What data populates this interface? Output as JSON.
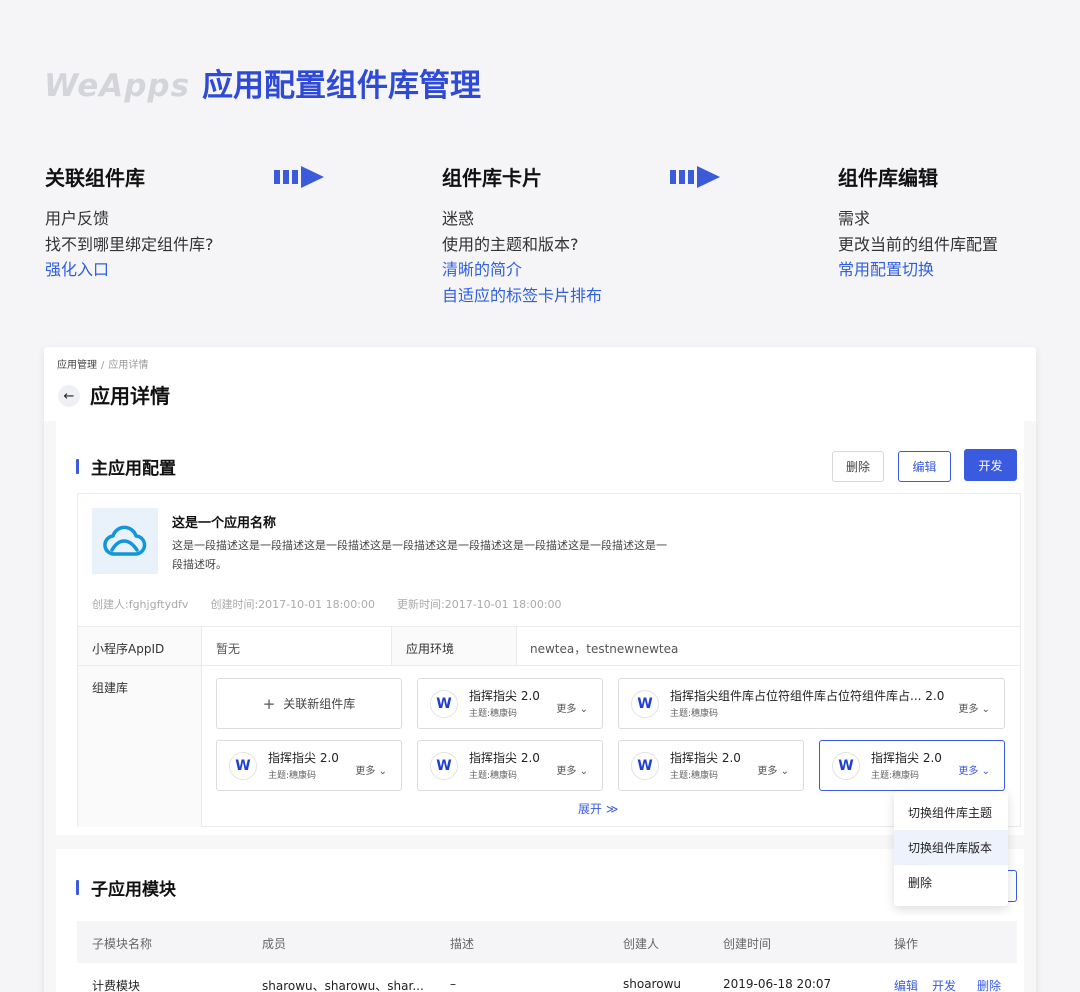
{
  "brand": {
    "logo": "WeApps",
    "title": "应用配置组件库管理"
  },
  "steps": [
    {
      "title": "关联组件库",
      "lines": [
        {
          "text": "用户反馈",
          "hl": false
        },
        {
          "text": "找不到哪里绑定组件库?",
          "hl": false
        },
        {
          "text": "强化入口",
          "hl": true
        }
      ]
    },
    {
      "title": "组件库卡片",
      "lines": [
        {
          "text": "迷惑",
          "hl": false
        },
        {
          "text": "使用的主题和版本?",
          "hl": false
        },
        {
          "text": "清晰的简介",
          "hl": true
        },
        {
          "text": "自适应的标签卡片排布",
          "hl": true
        }
      ]
    },
    {
      "title": "组件库编辑",
      "lines": [
        {
          "text": "需求",
          "hl": false
        },
        {
          "text": "更改当前的组件库配置",
          "hl": false
        },
        {
          "text": "常用配置切换",
          "hl": true
        }
      ]
    }
  ],
  "colors": {
    "accent": "#3a5be0",
    "arrow": "#3b5bdb",
    "brand_title": "#2f4bd6"
  },
  "page": {
    "breadcrumb": {
      "parent": "应用管理",
      "separator": "/",
      "current": "应用详情"
    },
    "back_icon": "arrow-left-icon",
    "title": "应用详情"
  },
  "main": {
    "section_title": "主应用配置",
    "buttons": {
      "delete": "删除",
      "edit": "编辑",
      "develop": "开发"
    },
    "app": {
      "icon": "cloud-icon",
      "name": "这是一个应用名称",
      "description": "这是一段描述这是一段描述这是一段描述这是一段描述这是一段描述这是一段描述这是一段描述这是一段描述呀。",
      "creator": "创建人:fghjgftydfv",
      "created": "创建时间:2017-10-01 18:00:00",
      "updated": "更新时间:2017-10-01 18:00:00"
    },
    "fields": {
      "appid_label": "小程序AppID",
      "appid_value": "暂无",
      "env_label": "应用环境",
      "env_value": "newtea，testnewnewtea",
      "libs_label": "组建库"
    },
    "add_lib_label": "关联新组件库",
    "libs": [
      {
        "name": "指挥指尖 2.0",
        "theme": "主题:穗康码",
        "more": "更多"
      },
      {
        "name": "指挥指尖组件库占位符组件库占位符组件库占... 2.0",
        "theme": "主题:穗康码",
        "more": "更多"
      },
      {
        "name": "指挥指尖 2.0",
        "theme": "主题:穗康码",
        "more": "更多"
      },
      {
        "name": "指挥指尖 2.0",
        "theme": "主题:穗康码",
        "more": "更多"
      },
      {
        "name": "指挥指尖 2.0",
        "theme": "主题:穗康码",
        "more": "更多"
      },
      {
        "name": "指挥指尖 2.0",
        "theme": "主题:穗康码",
        "more": "更多"
      }
    ],
    "lib_icon_letter": "W",
    "expand_label": "展开 ≫"
  },
  "dropdown": {
    "items": [
      "切换组件库主题",
      "切换组件库版本",
      "删除"
    ],
    "highlighted_index": 1
  },
  "sub": {
    "section_title": "子应用模块",
    "columns": [
      "子模块名称",
      "成员",
      "描述",
      "创建人",
      "创建时间",
      "操作"
    ],
    "row": {
      "name": "计费模块",
      "members": "sharowu、sharowu、shar...",
      "description": "–",
      "creator": "shoarowu",
      "created_at": "2019-06-18 20:07",
      "actions": [
        "编辑",
        "开发",
        "删除"
      ]
    }
  }
}
